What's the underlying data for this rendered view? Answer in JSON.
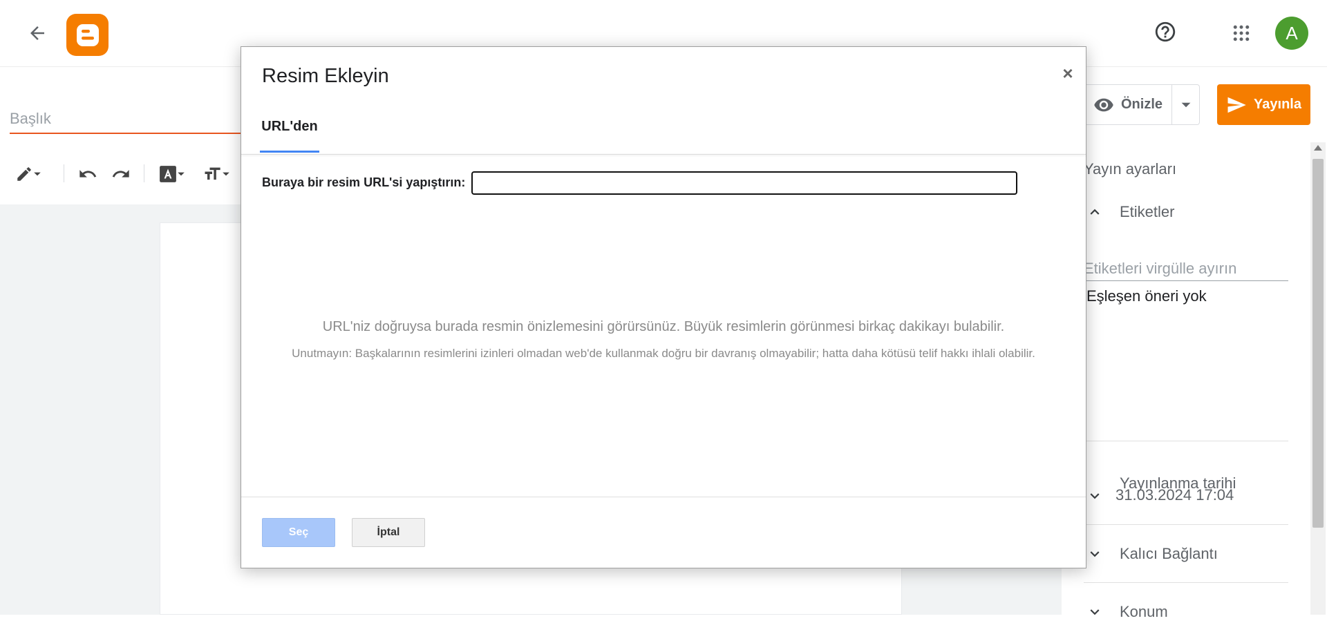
{
  "header": {
    "back_icon": "arrow-back-icon",
    "logo_icon": "blogger-logo-icon",
    "help_icon": "help-circle-icon",
    "apps_icon": "apps-grid-icon",
    "avatar_letter": "A",
    "avatar_color": "#4c9d2f"
  },
  "editor": {
    "title_placeholder": "Başlık",
    "toolbar_icons": [
      "pencil-icon",
      "undo-icon",
      "redo-icon",
      "text-color-icon",
      "font-size-icon"
    ]
  },
  "actions": {
    "preview_label": "Önizle",
    "publish_label": "Yayınla",
    "publish_color": "#f57d00"
  },
  "sidebar": {
    "heading": "Yayın ayarları",
    "labels_section": "Etiketler",
    "labels_placeholder": "Etiketleri virgülle ayırın",
    "no_match": "Eşleşen öneri yok",
    "publish_date_label": "Yayınlanma tarihi",
    "publish_date_value": "31.03.2024 17:04",
    "permalink_label": "Kalıcı Bağlantı",
    "location_label": "Konum"
  },
  "dialog": {
    "title": "Resim Ekleyin",
    "close_symbol": "×",
    "tab_label": "URL'den",
    "url_label": "Buraya bir resim URL'si yapıştırın:",
    "url_value": "",
    "preview_hint": "URL'niz doğruysa burada resmin önizlemesini görürsünüz. Büyük resimlerin görünmesi birkaç dakikayı bulabilir.",
    "warning": "Unutmayın: Başkalarının resimlerini izinleri olmadan web'de kullanmak doğru bir davranış olmayabilir; hatta daha kötüsü telif hakkı ihlali olabilir.",
    "select_label": "Seç",
    "cancel_label": "İptal",
    "accent_color": "#4285f4"
  }
}
